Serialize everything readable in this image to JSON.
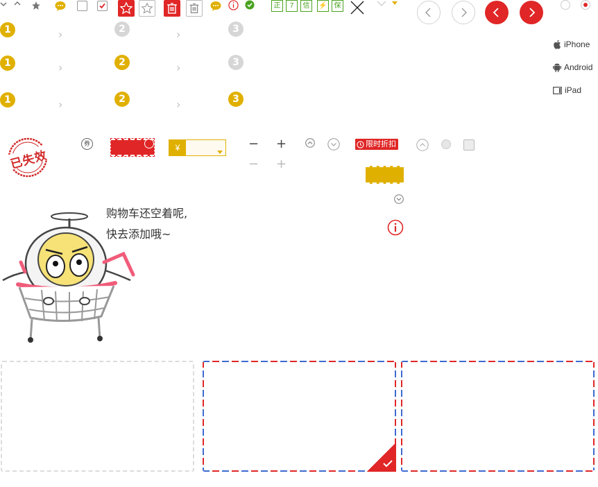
{
  "colors": {
    "accent_red": "#e02626",
    "gold": "#e0b000",
    "green": "#4aa31f",
    "gray": "#d6d6d6",
    "blue": "#3e6ad1"
  },
  "icon_strip": {
    "icons": [
      "chevron-down-icon",
      "chevron-up-icon",
      "star-icon",
      "chat-bubble-icon",
      "checkbox-unchecked-icon",
      "checkbox-checked-icon",
      "star-red-icon",
      "star-outline-icon",
      "trash-red-icon",
      "trash-outline-icon",
      "chat-bubble-icon",
      "info-red-icon",
      "check-green-icon"
    ],
    "green_badges": [
      "正",
      "7",
      "信",
      "⚡",
      "保"
    ]
  },
  "steps": {
    "rows": [
      {
        "values": [
          "1",
          "2",
          "3"
        ],
        "active": [
          true,
          false,
          false
        ]
      },
      {
        "values": [
          "1",
          "2",
          "3"
        ],
        "active": [
          true,
          true,
          false
        ]
      },
      {
        "values": [
          "1",
          "2",
          "3"
        ],
        "active": [
          true,
          true,
          true
        ]
      }
    ]
  },
  "platforms": [
    {
      "label": "iPhone",
      "icon": "apple-icon"
    },
    {
      "label": "Android",
      "icon": "android-icon"
    },
    {
      "label": "iPad",
      "icon": "tablet-icon"
    }
  ],
  "stamp": {
    "text": "已失效"
  },
  "coupon": {
    "circle_label": "券",
    "currency": "¥"
  },
  "quantity": {
    "minus": "−",
    "plus": "+"
  },
  "limited_tag": {
    "label": "限时折扣"
  },
  "empty_cart": {
    "line1": "购物车还空着呢,",
    "line2": "快去添加哦~"
  }
}
